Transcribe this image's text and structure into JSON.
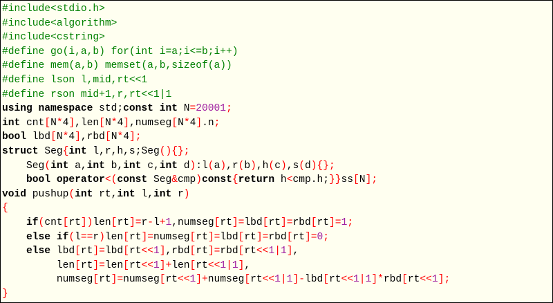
{
  "window": {
    "title": ""
  },
  "theme": {
    "background": "#fffff0",
    "preprocessor": "#008000",
    "keyword": "#000000",
    "identifier": "#000000",
    "operator": "#ff0000",
    "number": "#a020a0"
  },
  "code": {
    "lines": [
      [
        [
          "pp",
          "#include<stdio.h>"
        ]
      ],
      [
        [
          "pp",
          "#include<algorithm>"
        ]
      ],
      [
        [
          "pp",
          "#include<cstring>"
        ]
      ],
      [
        [
          "pp",
          "#define go(i,a,b) for(int i=a;i<=b;i++)"
        ]
      ],
      [
        [
          "pp",
          "#define mem(a,b) memset(a,b,sizeof(a))"
        ]
      ],
      [
        [
          "pp",
          "#define lson l,mid,rt<<1"
        ]
      ],
      [
        [
          "pp",
          "#define rson mid+1,r,rt<<1|1"
        ]
      ],
      [
        [
          "kw",
          "using namespace "
        ],
        [
          "id",
          "std;"
        ],
        [
          "kw",
          "const int "
        ],
        [
          "id",
          "N"
        ],
        [
          "op",
          "="
        ],
        [
          "num",
          "20001"
        ],
        [
          "op",
          ";"
        ]
      ],
      [
        [
          "kw",
          "int "
        ],
        [
          "id",
          "cnt"
        ],
        [
          "op",
          "["
        ],
        [
          "id",
          "N"
        ],
        [
          "op",
          "*"
        ],
        [
          "id",
          "4"
        ],
        [
          "op",
          "]"
        ],
        [
          "id",
          ",len"
        ],
        [
          "op",
          "["
        ],
        [
          "id",
          "N"
        ],
        [
          "op",
          "*"
        ],
        [
          "id",
          "4"
        ],
        [
          "op",
          "]"
        ],
        [
          "id",
          ",numseg"
        ],
        [
          "op",
          "["
        ],
        [
          "id",
          "N"
        ],
        [
          "op",
          "*"
        ],
        [
          "id",
          "4"
        ],
        [
          "op",
          "]"
        ],
        [
          "id",
          ".n"
        ],
        [
          "op",
          ";"
        ]
      ],
      [
        [
          "kw",
          "bool "
        ],
        [
          "id",
          "lbd"
        ],
        [
          "op",
          "["
        ],
        [
          "id",
          "N"
        ],
        [
          "op",
          "*"
        ],
        [
          "id",
          "4"
        ],
        [
          "op",
          "]"
        ],
        [
          "id",
          ",rbd"
        ],
        [
          "op",
          "["
        ],
        [
          "id",
          "N"
        ],
        [
          "op",
          "*"
        ],
        [
          "id",
          "4"
        ],
        [
          "op",
          "];"
        ]
      ],
      [
        [
          "kw",
          "struct "
        ],
        [
          "id",
          "Seg"
        ],
        [
          "op",
          "{"
        ],
        [
          "kw",
          "int "
        ],
        [
          "id",
          "l,r,h,s;Seg"
        ],
        [
          "op",
          "(){};"
        ]
      ],
      [
        [
          "id",
          "    Seg"
        ],
        [
          "op",
          "("
        ],
        [
          "kw",
          "int "
        ],
        [
          "id",
          "a,"
        ],
        [
          "kw",
          "int "
        ],
        [
          "id",
          "b,"
        ],
        [
          "kw",
          "int "
        ],
        [
          "id",
          "c,"
        ],
        [
          "kw",
          "int "
        ],
        [
          "id",
          "d"
        ],
        [
          "op",
          ")"
        ],
        [
          "id",
          ":l"
        ],
        [
          "op",
          "("
        ],
        [
          "id",
          "a"
        ],
        [
          "op",
          ")"
        ],
        [
          "id",
          ",r"
        ],
        [
          "op",
          "("
        ],
        [
          "id",
          "b"
        ],
        [
          "op",
          ")"
        ],
        [
          "id",
          ",h"
        ],
        [
          "op",
          "("
        ],
        [
          "id",
          "c"
        ],
        [
          "op",
          ")"
        ],
        [
          "id",
          ",s"
        ],
        [
          "op",
          "("
        ],
        [
          "id",
          "d"
        ],
        [
          "op",
          "){};"
        ]
      ],
      [
        [
          "kw",
          "    bool operator"
        ],
        [
          "op",
          "<("
        ],
        [
          "kw",
          "const "
        ],
        [
          "id",
          "Seg"
        ],
        [
          "op",
          "&"
        ],
        [
          "id",
          "cmp"
        ],
        [
          "op",
          ")"
        ],
        [
          "kw",
          "const"
        ],
        [
          "op",
          "{"
        ],
        [
          "kw",
          "return "
        ],
        [
          "id",
          "h"
        ],
        [
          "op",
          "<"
        ],
        [
          "id",
          "cmp.h;"
        ],
        [
          "op",
          "}}"
        ],
        [
          "id",
          "ss"
        ],
        [
          "op",
          "["
        ],
        [
          "id",
          "N"
        ],
        [
          "op",
          "];"
        ]
      ],
      [
        [
          "kw",
          "void "
        ],
        [
          "id",
          "pushup"
        ],
        [
          "op",
          "("
        ],
        [
          "kw",
          "int "
        ],
        [
          "id",
          "rt,"
        ],
        [
          "kw",
          "int "
        ],
        [
          "id",
          "l,"
        ],
        [
          "kw",
          "int "
        ],
        [
          "id",
          "r"
        ],
        [
          "op",
          ")"
        ]
      ],
      [
        [
          "op",
          "{"
        ]
      ],
      [
        [
          "kw",
          "    if"
        ],
        [
          "op",
          "("
        ],
        [
          "id",
          "cnt"
        ],
        [
          "op",
          "["
        ],
        [
          "id",
          "rt"
        ],
        [
          "op",
          "])"
        ],
        [
          "id",
          "len"
        ],
        [
          "op",
          "["
        ],
        [
          "id",
          "rt"
        ],
        [
          "op",
          "]="
        ],
        [
          "id",
          "r"
        ],
        [
          "op",
          "-"
        ],
        [
          "id",
          "l"
        ],
        [
          "op",
          "+"
        ],
        [
          "num",
          "1"
        ],
        [
          "id",
          ",numseg"
        ],
        [
          "op",
          "["
        ],
        [
          "id",
          "rt"
        ],
        [
          "op",
          "]="
        ],
        [
          "id",
          "lbd"
        ],
        [
          "op",
          "["
        ],
        [
          "id",
          "rt"
        ],
        [
          "op",
          "]="
        ],
        [
          "id",
          "rbd"
        ],
        [
          "op",
          "["
        ],
        [
          "id",
          "rt"
        ],
        [
          "op",
          "]="
        ],
        [
          "num",
          "1"
        ],
        [
          "op",
          ";"
        ]
      ],
      [
        [
          "kw",
          "    else if"
        ],
        [
          "op",
          "("
        ],
        [
          "id",
          "l"
        ],
        [
          "op",
          "=="
        ],
        [
          "id",
          "r"
        ],
        [
          "op",
          ")"
        ],
        [
          "id",
          "len"
        ],
        [
          "op",
          "["
        ],
        [
          "id",
          "rt"
        ],
        [
          "op",
          "]="
        ],
        [
          "id",
          "numseg"
        ],
        [
          "op",
          "["
        ],
        [
          "id",
          "rt"
        ],
        [
          "op",
          "]="
        ],
        [
          "id",
          "lbd"
        ],
        [
          "op",
          "["
        ],
        [
          "id",
          "rt"
        ],
        [
          "op",
          "]="
        ],
        [
          "id",
          "rbd"
        ],
        [
          "op",
          "["
        ],
        [
          "id",
          "rt"
        ],
        [
          "op",
          "]="
        ],
        [
          "num",
          "0"
        ],
        [
          "op",
          ";"
        ]
      ],
      [
        [
          "kw",
          "    else "
        ],
        [
          "id",
          "lbd"
        ],
        [
          "op",
          "["
        ],
        [
          "id",
          "rt"
        ],
        [
          "op",
          "]="
        ],
        [
          "id",
          "lbd"
        ],
        [
          "op",
          "["
        ],
        [
          "id",
          "rt"
        ],
        [
          "op",
          "<<"
        ],
        [
          "num",
          "1"
        ],
        [
          "op",
          "]"
        ],
        [
          "id",
          ",rbd"
        ],
        [
          "op",
          "["
        ],
        [
          "id",
          "rt"
        ],
        [
          "op",
          "]="
        ],
        [
          "id",
          "rbd"
        ],
        [
          "op",
          "["
        ],
        [
          "id",
          "rt"
        ],
        [
          "op",
          "<<"
        ],
        [
          "num",
          "1"
        ],
        [
          "op",
          "|"
        ],
        [
          "num",
          "1"
        ],
        [
          "op",
          "]"
        ],
        [
          "id",
          ","
        ]
      ],
      [
        [
          "id",
          "         len"
        ],
        [
          "op",
          "["
        ],
        [
          "id",
          "rt"
        ],
        [
          "op",
          "]="
        ],
        [
          "id",
          "len"
        ],
        [
          "op",
          "["
        ],
        [
          "id",
          "rt"
        ],
        [
          "op",
          "<<"
        ],
        [
          "num",
          "1"
        ],
        [
          "op",
          "]+"
        ],
        [
          "id",
          "len"
        ],
        [
          "op",
          "["
        ],
        [
          "id",
          "rt"
        ],
        [
          "op",
          "<<"
        ],
        [
          "num",
          "1"
        ],
        [
          "op",
          "|"
        ],
        [
          "num",
          "1"
        ],
        [
          "op",
          "]"
        ],
        [
          "id",
          ","
        ]
      ],
      [
        [
          "id",
          "         numseg"
        ],
        [
          "op",
          "["
        ],
        [
          "id",
          "rt"
        ],
        [
          "op",
          "]="
        ],
        [
          "id",
          "numseg"
        ],
        [
          "op",
          "["
        ],
        [
          "id",
          "rt"
        ],
        [
          "op",
          "<<"
        ],
        [
          "num",
          "1"
        ],
        [
          "op",
          "]+"
        ],
        [
          "id",
          "numseg"
        ],
        [
          "op",
          "["
        ],
        [
          "id",
          "rt"
        ],
        [
          "op",
          "<<"
        ],
        [
          "num",
          "1"
        ],
        [
          "op",
          "|"
        ],
        [
          "num",
          "1"
        ],
        [
          "op",
          "]-"
        ],
        [
          "id",
          "lbd"
        ],
        [
          "op",
          "["
        ],
        [
          "id",
          "rt"
        ],
        [
          "op",
          "<<"
        ],
        [
          "num",
          "1"
        ],
        [
          "op",
          "|"
        ],
        [
          "num",
          "1"
        ],
        [
          "op",
          "]*"
        ],
        [
          "id",
          "rbd"
        ],
        [
          "op",
          "["
        ],
        [
          "id",
          "rt"
        ],
        [
          "op",
          "<<"
        ],
        [
          "num",
          "1"
        ],
        [
          "op",
          "];"
        ]
      ],
      [
        [
          "op",
          "}"
        ]
      ]
    ]
  }
}
